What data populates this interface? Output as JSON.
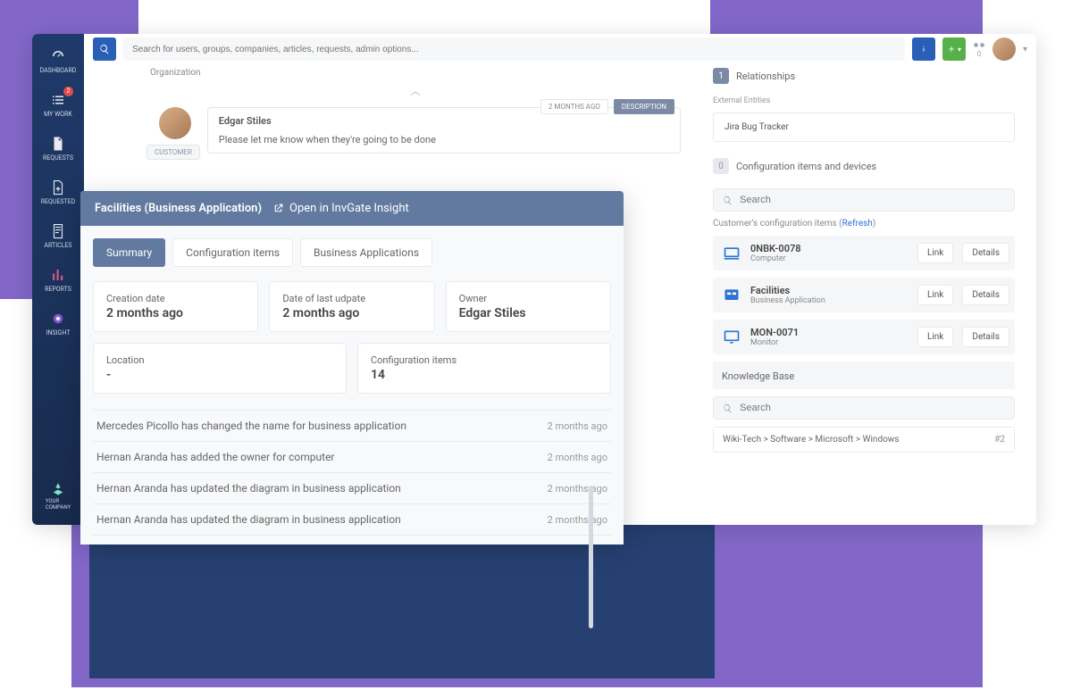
{
  "sidenav": {
    "items": [
      {
        "label": "DASHBOARD"
      },
      {
        "label": "MY WORK",
        "badge": "2"
      },
      {
        "label": "REQUESTS"
      },
      {
        "label": "REQUESTED"
      },
      {
        "label": "ARTICLES"
      },
      {
        "label": "REPORTS"
      },
      {
        "label": "INSIGHT"
      }
    ],
    "company": "YOUR\nCOMPANY"
  },
  "topbar": {
    "search_placeholder": "Search for users, groups, companies, articles, requests, admin options...",
    "counter": "0"
  },
  "center": {
    "org_label": "Organization",
    "customer_tag": "CUSTOMER",
    "author": "Edgar Stiles",
    "body": "Please let me know when they're going to be done",
    "time_tag": "2 MONTHS AGO",
    "desc_tag": "DESCRIPTION"
  },
  "overlay": {
    "title": "Facilities (Business Application)",
    "open_label": "Open in InvGate Insight",
    "tabs": [
      "Summary",
      "Configuration items",
      "Business Applications"
    ],
    "cards": [
      {
        "label": "Creation date",
        "value": "2 months ago"
      },
      {
        "label": "Date of last udpate",
        "value": "2 months ago"
      },
      {
        "label": "Owner",
        "value": "Edgar Stiles"
      }
    ],
    "cards2": [
      {
        "label": "Location",
        "value": "-"
      },
      {
        "label": "Configuration items",
        "value": "14"
      }
    ],
    "log": [
      {
        "text": "Mercedes Picollo has changed the name for business application",
        "time": "2 months ago"
      },
      {
        "text": "Hernan Aranda has added the owner for computer",
        "time": "2 months ago"
      },
      {
        "text": "Hernan Aranda has updated the diagram in business application",
        "time": "2 months ago"
      },
      {
        "text": "Hernan Aranda has updated the diagram in business application",
        "time": "2 months ago"
      }
    ]
  },
  "right": {
    "rel_badge": "1",
    "rel_label": "Relationships",
    "ext_label": "External Entities",
    "ext_value": "Jira Bug Tracker",
    "cfg_badge": "0",
    "cfg_label": "Configuration items and devices",
    "search_ph": "Search",
    "cfg_note_pre": "Customer's configuration items (",
    "cfg_note_link": "Refresh",
    "cfg_note_post": ")",
    "ci": [
      {
        "name": "0NBK-0078",
        "type": "Computer"
      },
      {
        "name": "Facilities",
        "type": "Business Application"
      },
      {
        "name": "MON-0071",
        "type": "Monitor"
      }
    ],
    "link_btn": "Link",
    "details_btn": "Details",
    "kb_label": "Knowledge Base",
    "kb_crumb": "Wiki-Tech > Software > Microsoft > Windows",
    "kb_num": "#2"
  }
}
